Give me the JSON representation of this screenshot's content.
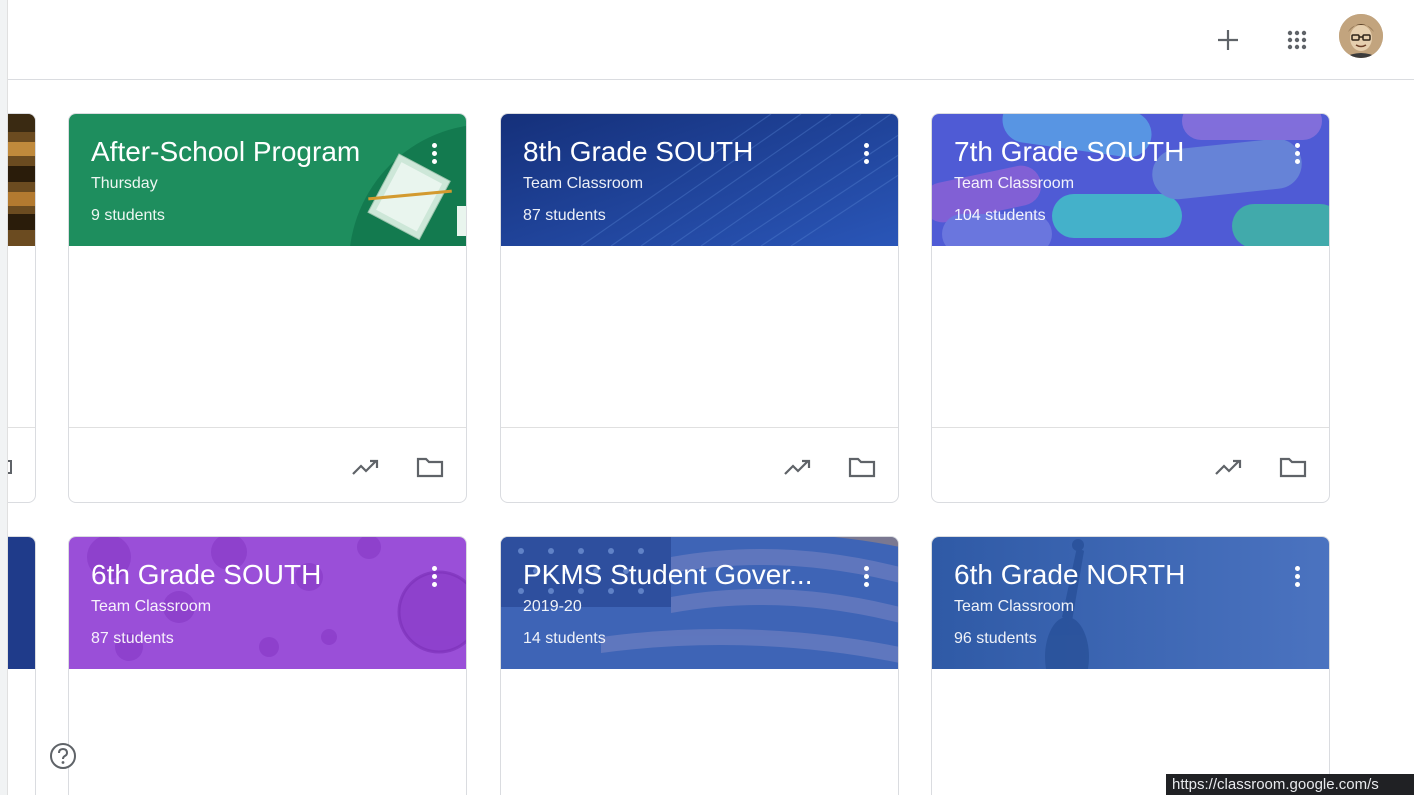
{
  "topbar": {
    "add_icon": "plus-icon",
    "apps_icon": "apps-grid-icon",
    "avatar_icon": "user-avatar"
  },
  "classes": [
    {
      "title": "After-School Program",
      "section": "Thursday",
      "students": "9 students",
      "color": "#1e8e5e"
    },
    {
      "title": "8th Grade SOUTH",
      "section": "Team Classroom",
      "students": "87 students",
      "color": "#1a3a86"
    },
    {
      "title": "7th Grade SOUTH",
      "section": "Team Classroom",
      "students": "104 students",
      "color": "#4a5bd4"
    },
    {
      "title": "6th Grade SOUTH",
      "section": "Team Classroom",
      "students": "87 students",
      "color": "#9a4fd8"
    },
    {
      "title": "PKMS Student Gover...",
      "section": "2019-20",
      "students": "14 students",
      "color": "#3e64b6"
    },
    {
      "title": "6th Grade NORTH",
      "section": "Team Classroom",
      "students": "96 students",
      "color": "#3a64b0"
    }
  ],
  "footer_icons": [
    "trending-up-icon",
    "folder-icon"
  ],
  "help_icon": "help-icon",
  "status_bar": {
    "url": "https://classroom.google.com/s"
  }
}
